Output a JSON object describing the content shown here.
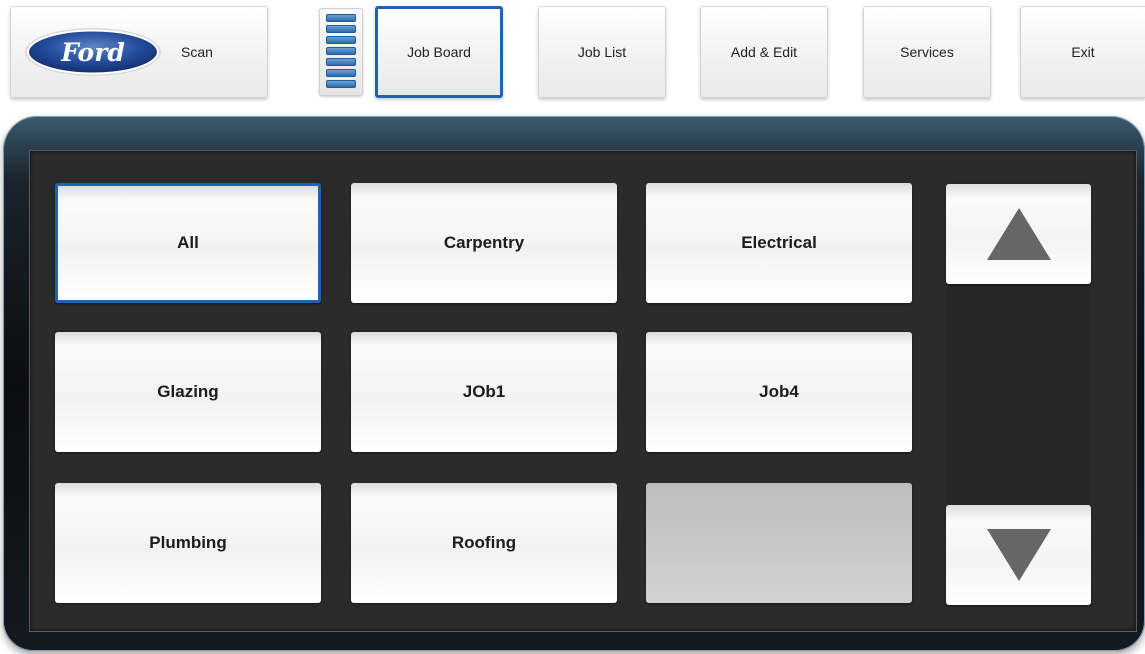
{
  "toolbar": {
    "scan_label": "Scan",
    "job_board_label": "Job Board",
    "job_list_label": "Job List",
    "add_edit_label": "Add & Edit",
    "services_label": "Services",
    "exit_label": "Exit",
    "logo_text": "Ford",
    "active": "Job Board"
  },
  "categories": {
    "row1": [
      "All",
      "Carpentry",
      "Electrical"
    ],
    "row2": [
      "Glazing",
      "JOb1",
      "Job4"
    ],
    "row3": [
      "Plumbing",
      "Roofing",
      ""
    ],
    "selected": "All"
  },
  "scroll": {
    "up_icon": "triangle-up",
    "down_icon": "triangle-down"
  },
  "colors": {
    "accent": "#1f62ad",
    "logo_blue": "#1a3f8c",
    "panel_bg": "#2b2b2b"
  }
}
